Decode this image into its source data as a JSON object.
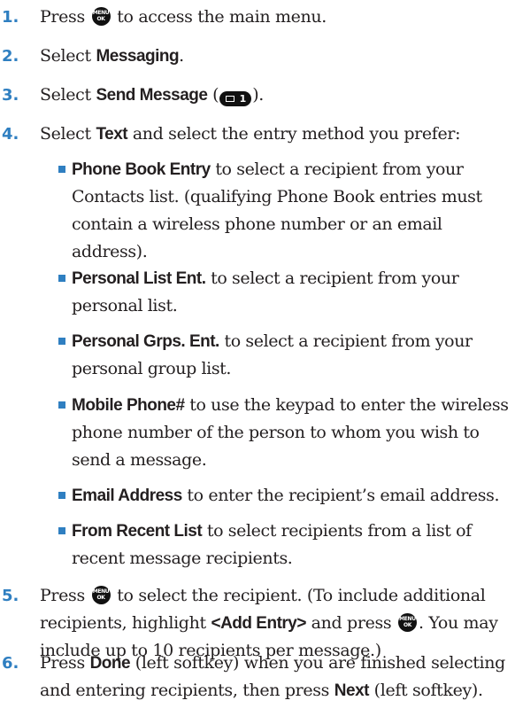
{
  "colors": {
    "accent_blue": "#2f7fc1",
    "text": "#231f20",
    "key_black": "#111111"
  },
  "icons": {
    "menu_ok_key": "menu-ok-key-icon",
    "softkey_pill": "send-message-envelope-1-icon"
  },
  "menu_key": {
    "line1": "MENU",
    "line2": "OK"
  },
  "send_message_shortcut": {
    "digit": "1"
  },
  "steps": [
    {
      "number": "1.",
      "before": "Press ",
      "after": " to access the main menu."
    },
    {
      "number": "2.",
      "before": "Select ",
      "bold": "Messaging",
      "after": "."
    },
    {
      "number": "3.",
      "before": "Select ",
      "bold": "Send Message",
      "mid": " (",
      "after": ")."
    },
    {
      "number": "4.",
      "before": "Select ",
      "bold": "Text",
      "after": " and select the entry method you prefer:"
    },
    {
      "number": "5.",
      "before": "Press ",
      "mid1": " to select the recipient. (To include additional recipients, highlight ",
      "bold": "<Add Entry>",
      "mid2": " and press ",
      "after": ". You may include up to 10 recipients per message.)"
    },
    {
      "number": "6.",
      "before": "Press ",
      "bold1": "Done",
      "mid": " (left softkey) when you are finished selecting and entering recipients, then press ",
      "bold2": "Next",
      "after": " (left softkey)."
    }
  ],
  "entry_methods": [
    {
      "bold": "Phone Book Entry",
      "text": " to select a recipient from your Contacts list. (qualifying Phone Book entries must contain a wireless phone number or an email address)."
    },
    {
      "bold": "Personal List Ent.",
      "text": " to select a recipient from your personal list."
    },
    {
      "bold": "Personal Grps. Ent.",
      "text": " to select a recipient from your personal group list."
    },
    {
      "bold": "Mobile Phone#",
      "text": " to use the keypad to enter the wireless phone number of the person to whom you wish to send a message."
    },
    {
      "bold": "Email Address",
      "text": " to enter the recipient’s email address."
    },
    {
      "bold": "From Recent List",
      "text": " to select recipients from a list of recent message recipients."
    }
  ]
}
